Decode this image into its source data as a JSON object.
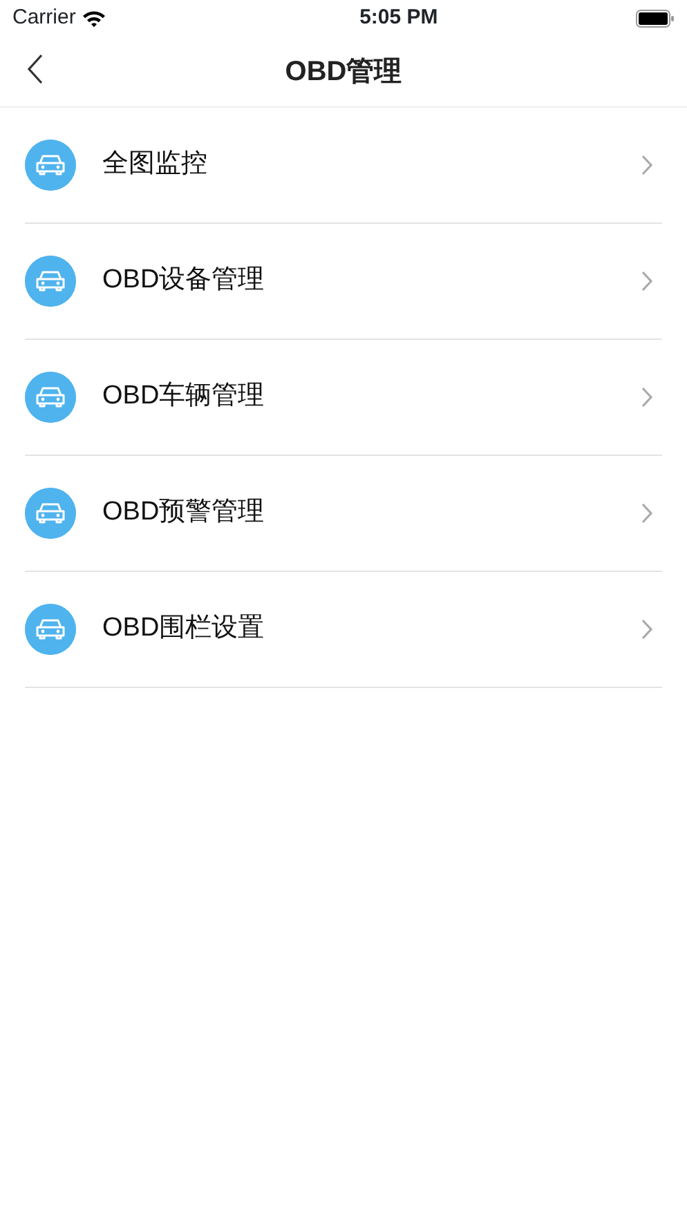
{
  "status_bar": {
    "carrier": "Carrier",
    "time": "5:05 PM"
  },
  "nav": {
    "title": "OBD管理"
  },
  "menu": [
    {
      "label": "全图监控"
    },
    {
      "label": "OBD设备管理"
    },
    {
      "label": "OBD车辆管理"
    },
    {
      "label": "OBD预警管理"
    },
    {
      "label": "OBD围栏设置"
    }
  ]
}
